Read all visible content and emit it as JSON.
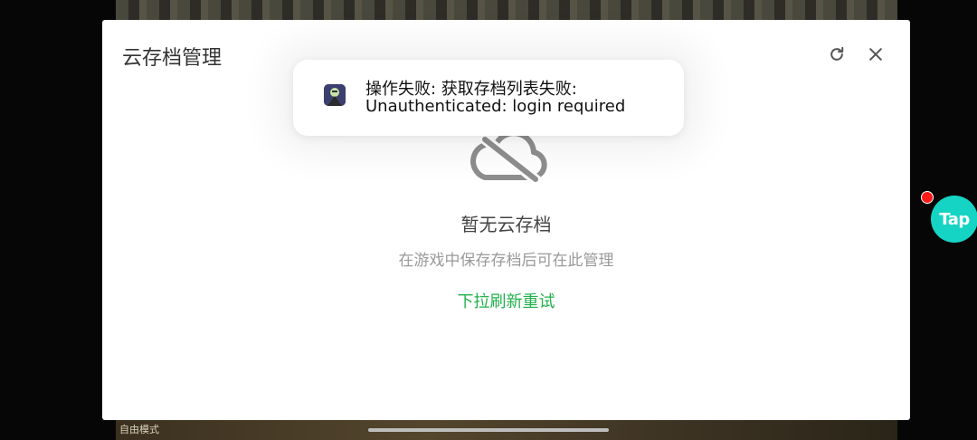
{
  "dialog": {
    "title": "云存档管理",
    "refresh_icon": "refresh-icon",
    "close_icon": "close-icon"
  },
  "empty_state": {
    "icon": "cloud-off-icon",
    "title": "暂无云存档",
    "subtitle": "在游戏中保存存档后可在此管理",
    "retry_label": "下拉刷新重试"
  },
  "toast": {
    "line1": "操作失败: 获取存档列表失败:",
    "line2": "Unauthenticated: login required",
    "icon": "game-app-icon"
  },
  "floating": {
    "label": "Tap",
    "color": "#16d4c4",
    "badge_color": "#ff1a1a"
  },
  "game": {
    "mode_label": "自由模式"
  },
  "colors": {
    "accent_green": "#22b14c"
  }
}
